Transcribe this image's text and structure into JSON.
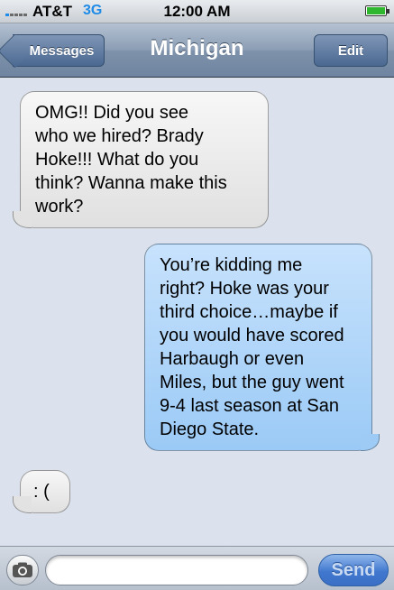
{
  "status_bar": {
    "carrier": "AT&T",
    "network": "3G",
    "time": "12:00 AM",
    "battery_level": 1.0,
    "signal_icon": "signal-bars-icon",
    "battery_icon": "battery-icon"
  },
  "nav_bar": {
    "back_label": "Messages",
    "title": "Michigan",
    "edit_label": "Edit"
  },
  "messages": [
    {
      "direction": "received",
      "text": "OMG!! Did you see\nwho we hired? Brady\nHoke!!! What do you\nthink? Wanna make this\nwork?"
    },
    {
      "direction": "sent",
      "text": "You’re kidding me\nright? Hoke was your\nthird choice…maybe if\nyou would have scored\nHarbaugh or even\nMiles, but the guy went\n9-4 last season at San\nDiego State."
    },
    {
      "direction": "received",
      "text": ": ("
    }
  ],
  "input_bar": {
    "camera_icon": "camera-icon",
    "text_value": "",
    "send_label": "Send"
  },
  "colors": {
    "received_bubble": "#e9e9e9",
    "sent_bubble": "#aed3f8",
    "background": "#dbe2ed",
    "nav_bar": "#8b9db4",
    "network_label": "#1f8be6"
  }
}
